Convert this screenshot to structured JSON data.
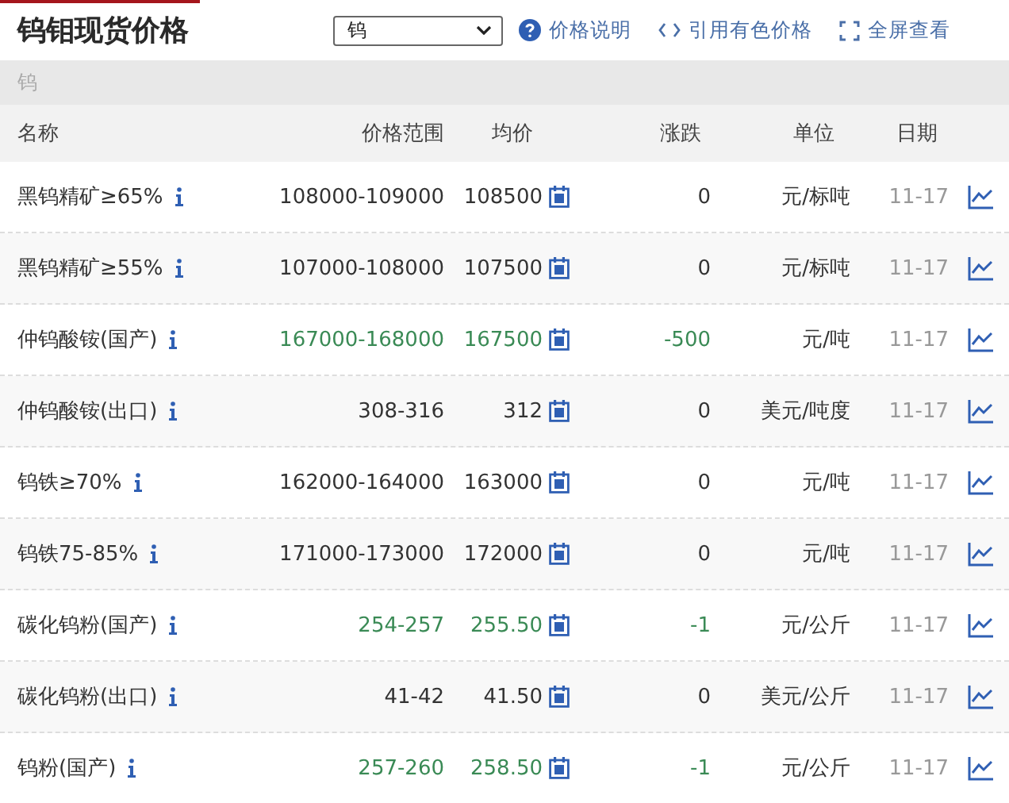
{
  "title": "钨钼现货价格",
  "select": {
    "value": "钨"
  },
  "links": [
    {
      "kind": "help",
      "label": "价格说明"
    },
    {
      "kind": "cite",
      "label": "引用有色价格"
    },
    {
      "kind": "fullscreen",
      "label": "全屏查看"
    }
  ],
  "section": "钨",
  "columns": [
    "名称",
    "价格范围",
    "均价",
    "涨跌",
    "单位",
    "日期"
  ],
  "rows": [
    {
      "name": "黑钨精矿≥65%",
      "range": "108000-109000",
      "avg": "108500",
      "change": "0",
      "falling": false,
      "unit": "元/标吨",
      "date": "11-17"
    },
    {
      "name": "黑钨精矿≥55%",
      "range": "107000-108000",
      "avg": "107500",
      "change": "0",
      "falling": false,
      "unit": "元/标吨",
      "date": "11-17"
    },
    {
      "name": "仲钨酸铵(国产)",
      "range": "167000-168000",
      "avg": "167500",
      "change": "-500",
      "falling": true,
      "unit": "元/吨",
      "date": "11-17"
    },
    {
      "name": "仲钨酸铵(出口)",
      "range": "308-316",
      "avg": "312",
      "change": "0",
      "falling": false,
      "unit": "美元/吨度",
      "date": "11-17"
    },
    {
      "name": "钨铁≥70%",
      "range": "162000-164000",
      "avg": "163000",
      "change": "0",
      "falling": false,
      "unit": "元/吨",
      "date": "11-17"
    },
    {
      "name": "钨铁75-85%",
      "range": "171000-173000",
      "avg": "172000",
      "change": "0",
      "falling": false,
      "unit": "元/吨",
      "date": "11-17"
    },
    {
      "name": "碳化钨粉(国产)",
      "range": "254-257",
      "avg": "255.50",
      "change": "-1",
      "falling": true,
      "unit": "元/公斤",
      "date": "11-17"
    },
    {
      "name": "碳化钨粉(出口)",
      "range": "41-42",
      "avg": "41.50",
      "change": "0",
      "falling": false,
      "unit": "美元/公斤",
      "date": "11-17"
    },
    {
      "name": "钨粉(国产)",
      "range": "257-260",
      "avg": "258.50",
      "change": "-1",
      "falling": true,
      "unit": "元/公斤",
      "date": "11-17"
    }
  ]
}
